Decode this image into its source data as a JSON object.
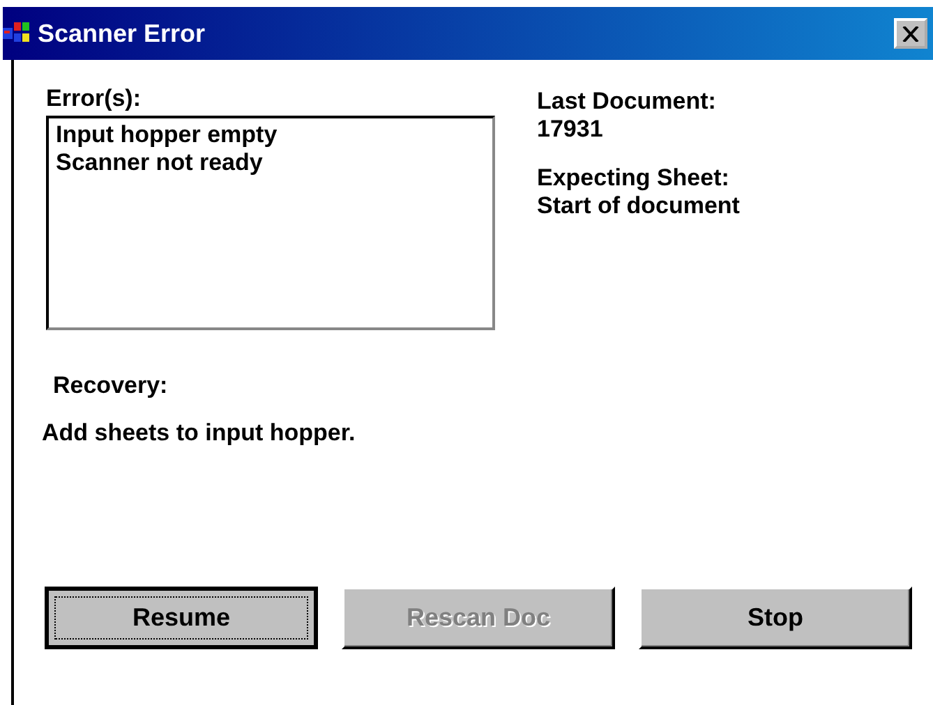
{
  "window": {
    "title": "Scanner Error"
  },
  "errors": {
    "label": "Error(s):",
    "items": [
      "Input hopper empty",
      "Scanner not ready"
    ]
  },
  "info": [
    {
      "label": "Last Document:",
      "value": "17931"
    },
    {
      "label": "Expecting Sheet:",
      "value": "Start of document"
    }
  ],
  "recovery": {
    "label": "Recovery:",
    "text": "Add sheets to input hopper."
  },
  "buttons": [
    {
      "label": "Resume",
      "default": true,
      "disabled": false
    },
    {
      "label": "Rescan Doc",
      "default": false,
      "disabled": true
    },
    {
      "label": "Stop",
      "default": false,
      "disabled": false
    }
  ]
}
